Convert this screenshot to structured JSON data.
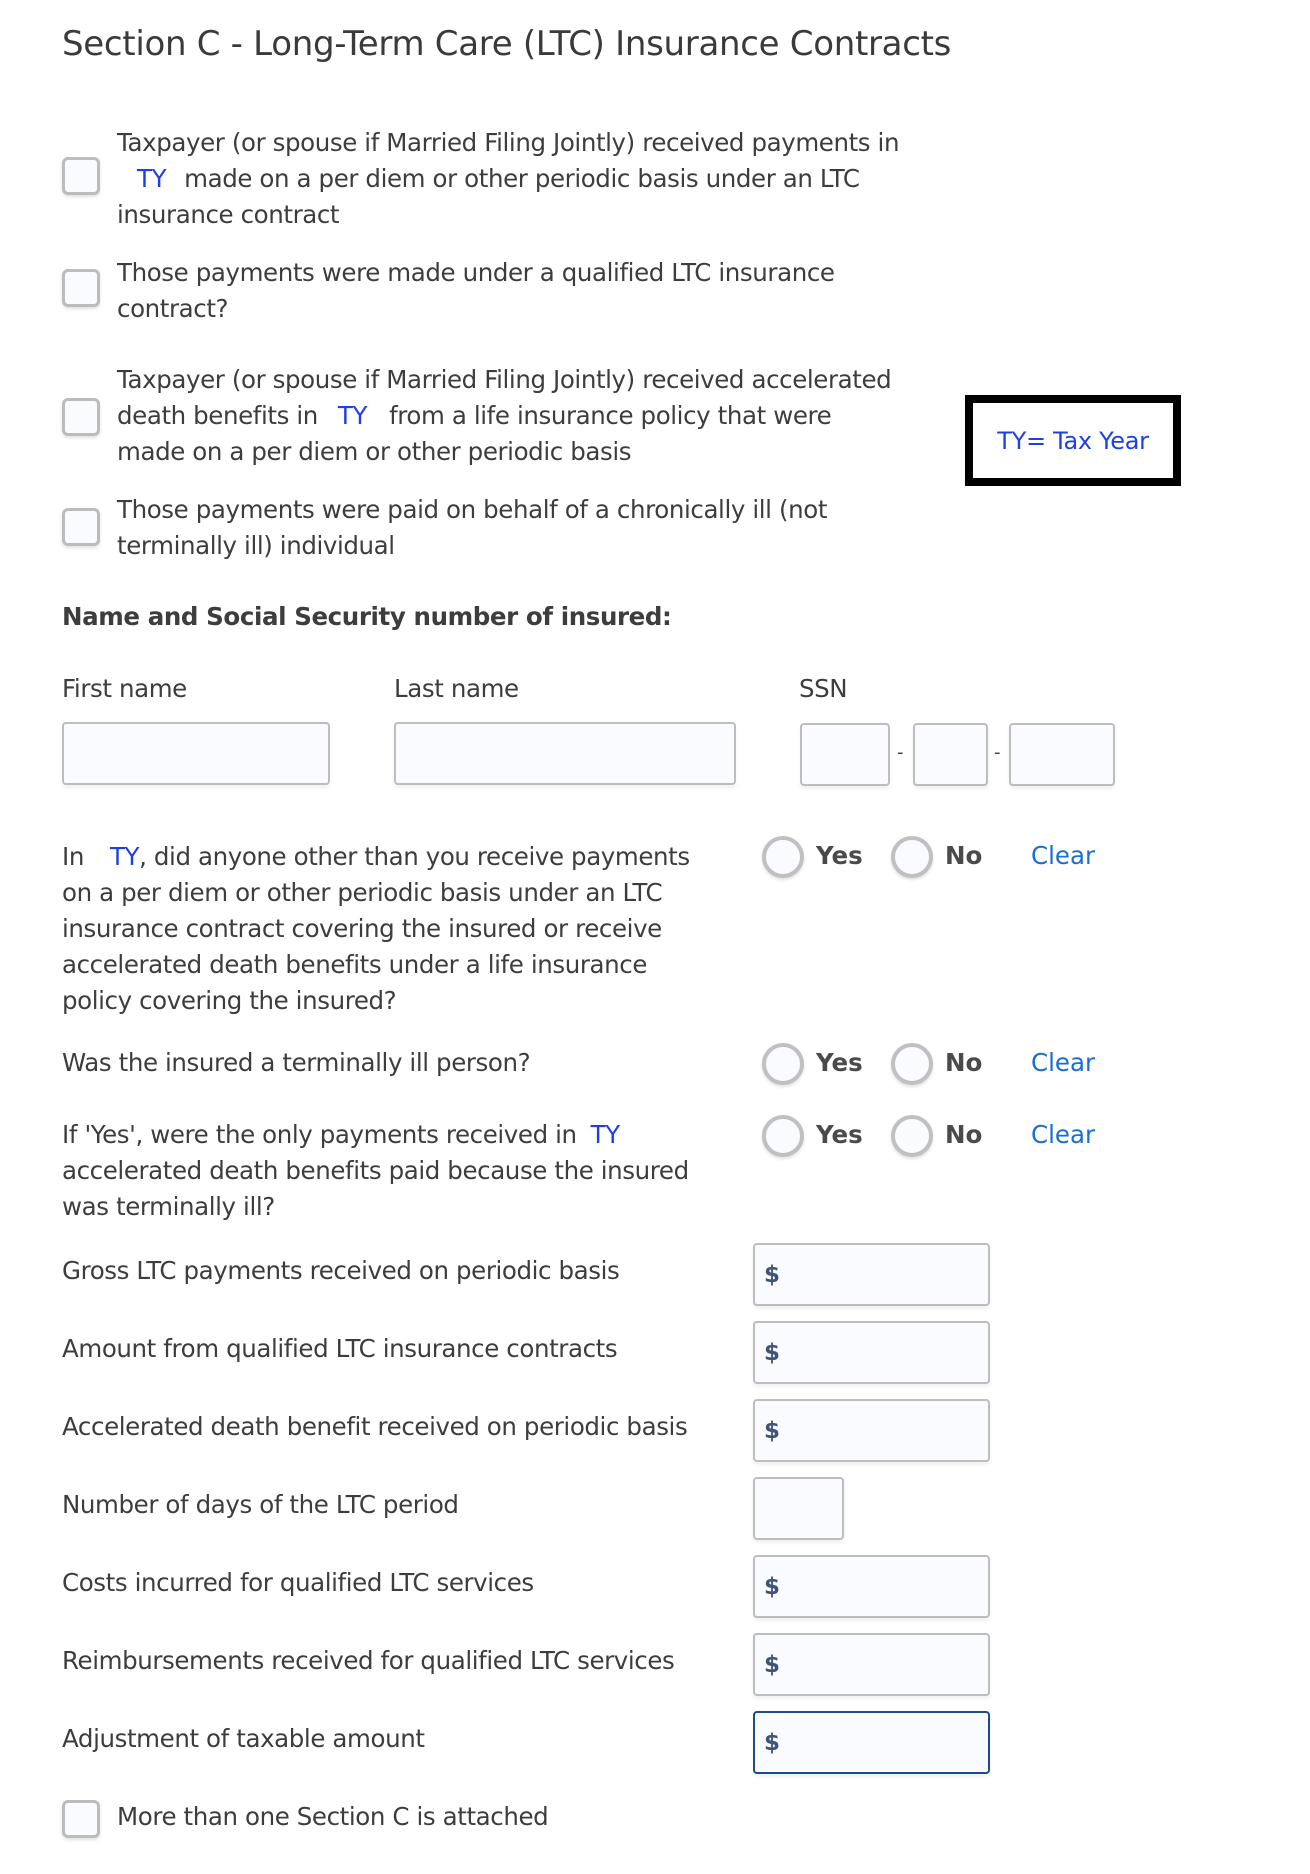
{
  "section": {
    "title": "Section C - Long-Term Care (LTC) Insurance Contracts"
  },
  "legend": {
    "text": "TY= Tax Year"
  },
  "checkboxes": [
    {
      "line1": "Taxpayer (or spouse if Married Filing Jointly) received payments in",
      "ty": "TY",
      "line2_after": "made on a per diem or other periodic basis under an LTC",
      "line3": "insurance contract",
      "checked": false
    },
    {
      "line1": "Those payments were made under a qualified LTC insurance",
      "line2": "contract?",
      "checked": false
    },
    {
      "line1": "Taxpayer (or spouse if Married Filing Jointly) received accelerated",
      "line2_before": "death benefits in",
      "ty": "TY",
      "line2_after": "from a life insurance policy that were",
      "line3": "made on a per diem or other periodic basis",
      "checked": false
    },
    {
      "line1": "Those payments were paid on behalf of a chronically ill (not",
      "line2": "terminally ill) individual",
      "checked": false
    }
  ],
  "insured": {
    "heading": "Name and Social Security number of insured:",
    "first_name_label": "First name",
    "last_name_label": "Last name",
    "ssn_label": "SSN",
    "first_name_value": "",
    "last_name_value": "",
    "ssn_part1": "",
    "ssn_part2": "",
    "ssn_part3": "",
    "ssn_separator": "-"
  },
  "questions": [
    {
      "pre": "In",
      "ty": "TY",
      "post": ", did anyone other than you receive payments",
      "lines": [
        "on a per diem or other periodic basis under an LTC",
        "insurance contract covering the insured or receive",
        "accelerated death benefits under a life insurance",
        "policy covering the insured?"
      ],
      "yes_label": "Yes",
      "no_label": "No",
      "clear_label": "Clear",
      "selected": null
    },
    {
      "text": "Was the insured a terminally ill person?",
      "yes_label": "Yes",
      "no_label": "No",
      "clear_label": "Clear",
      "selected": null
    },
    {
      "pre": "If 'Yes', were the only payments received in",
      "ty": "TY",
      "lines": [
        "accelerated death benefits paid because the insured",
        "was terminally ill?"
      ],
      "yes_label": "Yes",
      "no_label": "No",
      "clear_label": "Clear",
      "selected": null
    }
  ],
  "amounts": [
    {
      "label": "Gross LTC payments received on periodic basis",
      "currency": "$",
      "value": ""
    },
    {
      "label": "Amount from qualified LTC insurance contracts",
      "currency": "$",
      "value": ""
    },
    {
      "label": "Accelerated death benefit received on periodic basis",
      "currency": "$",
      "value": ""
    },
    {
      "label": "Number of days of the LTC period",
      "currency": "",
      "value": ""
    },
    {
      "label": "Costs incurred for qualified LTC services",
      "currency": "$",
      "value": ""
    },
    {
      "label": "Reimbursements received for qualified LTC services",
      "currency": "$",
      "value": ""
    },
    {
      "label": "Adjustment of taxable amount",
      "currency": "$",
      "value": "",
      "focused": true
    }
  ],
  "footer_checkbox": {
    "label": "More than one Section C is attached",
    "checked": false
  }
}
